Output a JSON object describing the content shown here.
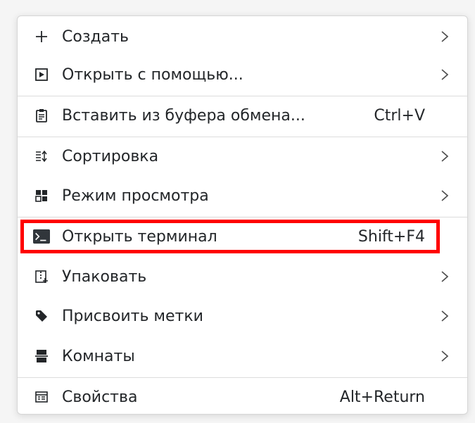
{
  "menu": {
    "items": [
      {
        "label": "Создать",
        "icon": "plus-icon",
        "submenu": true
      },
      {
        "label": "Открыть с помощью...",
        "icon": "open-with-icon",
        "submenu": true
      },
      {
        "label": "Вставить из буфера обмена...",
        "icon": "clipboard-icon",
        "shortcut": "Ctrl+V"
      },
      {
        "label": "Сортировка",
        "icon": "sort-icon",
        "submenu": true
      },
      {
        "label": "Режим просмотра",
        "icon": "view-mode-icon",
        "submenu": true
      },
      {
        "label": "Открыть терминал",
        "icon": "terminal-icon",
        "shortcut": "Shift+F4",
        "highlighted": true
      },
      {
        "label": "Упаковать",
        "icon": "compress-icon",
        "submenu": true
      },
      {
        "label": "Присвоить метки",
        "icon": "tag-icon",
        "submenu": true
      },
      {
        "label": "Комнаты",
        "icon": "activities-icon",
        "submenu": true
      },
      {
        "label": "Свойства",
        "icon": "properties-icon",
        "shortcut": "Alt+Return"
      }
    ]
  },
  "colors": {
    "highlight_border": "#ff0000",
    "text": "#232629",
    "separator": "#dcdcdc"
  }
}
